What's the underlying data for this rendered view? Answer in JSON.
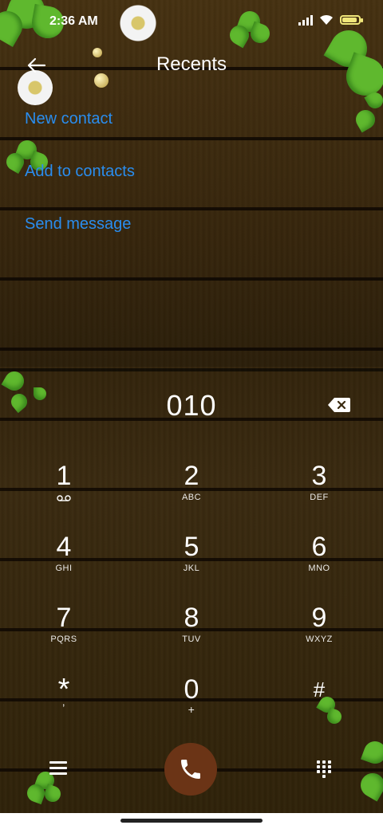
{
  "status": {
    "time": "2:36 AM"
  },
  "header": {
    "title": "Recents"
  },
  "actions": [
    "New contact",
    "Add to contacts",
    "Send message"
  ],
  "dialer": {
    "number": "010",
    "keys": [
      {
        "digit": "1",
        "letters": ""
      },
      {
        "digit": "2",
        "letters": "ABC"
      },
      {
        "digit": "3",
        "letters": "DEF"
      },
      {
        "digit": "4",
        "letters": "GHI"
      },
      {
        "digit": "5",
        "letters": "JKL"
      },
      {
        "digit": "6",
        "letters": "MNO"
      },
      {
        "digit": "7",
        "letters": "PQRS"
      },
      {
        "digit": "8",
        "letters": "TUV"
      },
      {
        "digit": "9",
        "letters": "WXYZ"
      },
      {
        "digit": "*",
        "letters": ","
      },
      {
        "digit": "0",
        "letters": "+"
      },
      {
        "digit": "#",
        "letters": ""
      }
    ]
  },
  "icons": {
    "back": "arrow-left-icon",
    "backspace": "backspace-icon",
    "voicemail": "voicemail-icon",
    "menu": "menu-icon",
    "call": "phone-icon",
    "keypad": "dialpad-icon"
  },
  "colors": {
    "link": "#2a8dee",
    "call_button": "#6b3416",
    "battery": "#f0e67a"
  }
}
